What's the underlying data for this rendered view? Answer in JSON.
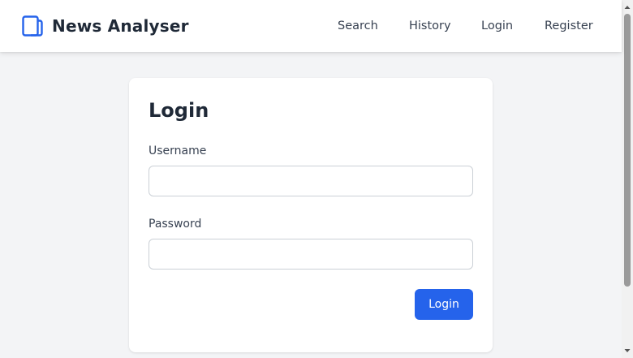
{
  "brand": {
    "name": "News Analyser",
    "icon": "tablet-icon",
    "accent_color": "#2563eb"
  },
  "nav": {
    "items": [
      {
        "label": "Search"
      },
      {
        "label": "History"
      },
      {
        "label": "Login"
      },
      {
        "label": "Register"
      }
    ]
  },
  "login_form": {
    "title": "Login",
    "username_label": "Username",
    "username_value": "",
    "password_label": "Password",
    "password_value": "",
    "submit_label": "Login",
    "button_color": "#2563eb"
  },
  "icons": {
    "scroll_up": "chevron-up-icon",
    "scroll_down": "chevron-down-icon"
  }
}
